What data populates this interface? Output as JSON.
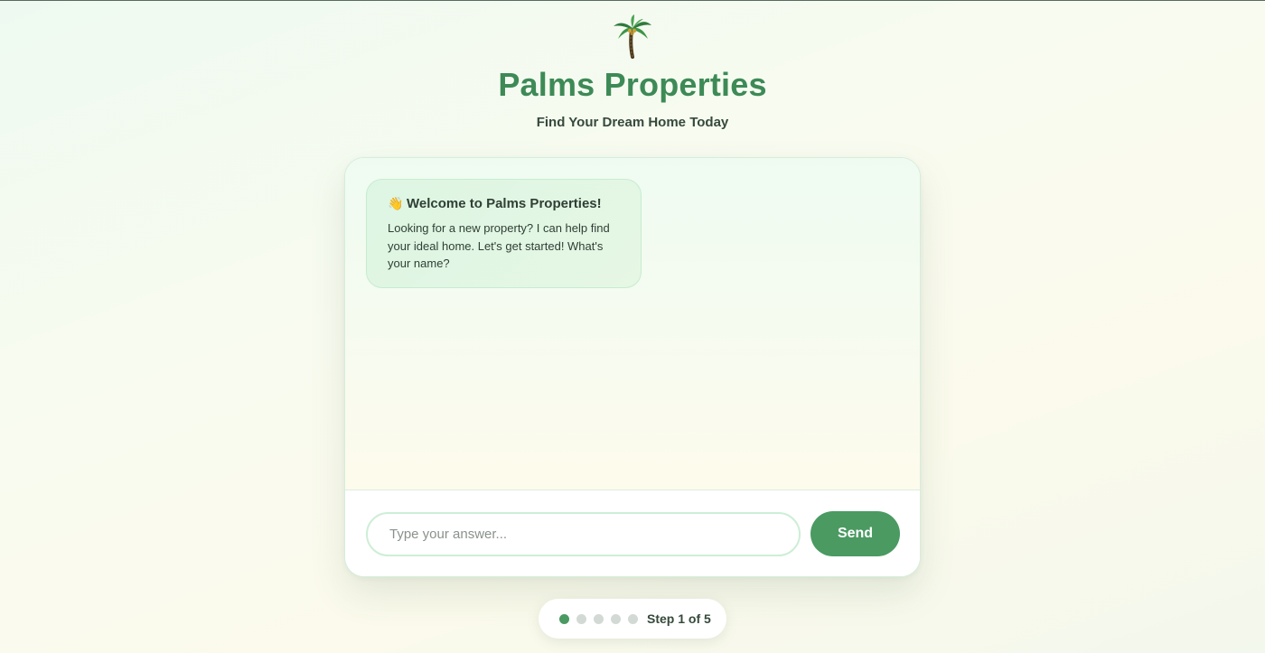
{
  "header": {
    "logo_icon": "palm-tree-icon",
    "title": "Palms Properties",
    "subtitle": "Find Your Dream Home Today",
    "accent_color": "#3d8a56"
  },
  "chat": {
    "messages": [
      {
        "sender": "bot",
        "icon": "waving-hand-icon",
        "emoji": "👋",
        "heading": "Welcome to Palms Properties!",
        "text": "Looking for a new property? I can help find your ideal home. Let's get started! What's your name?"
      }
    ],
    "input": {
      "value": "",
      "placeholder": "Type your answer..."
    },
    "send_label": "Send",
    "send_color": "#4a9a62"
  },
  "progress": {
    "current_step": 1,
    "total_steps": 5,
    "label": "Step 1 of 5"
  }
}
